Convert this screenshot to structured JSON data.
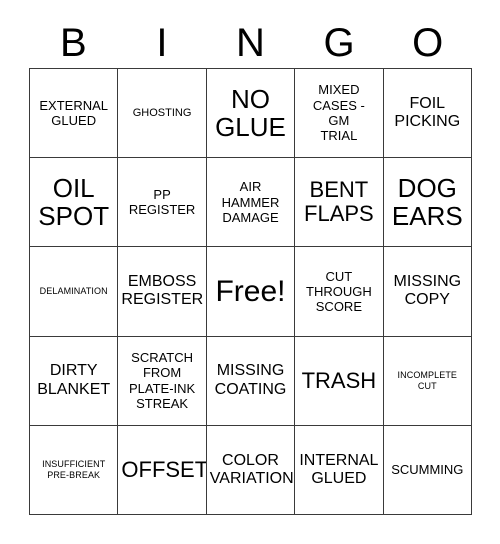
{
  "card": {
    "title": "BINGO",
    "header_letters": [
      "B",
      "I",
      "N",
      "G",
      "O"
    ],
    "colors": {
      "background": "#ffffff",
      "text": "#000000",
      "grid_line": "#3a3a3a"
    },
    "free_space": {
      "row": 3,
      "column": 3,
      "label": "Free!"
    },
    "rows": [
      [
        {
          "text": "EXTERNAL\nGLUED",
          "size": "sm"
        },
        {
          "text": "GHOSTING",
          "size": "xs"
        },
        {
          "text": "NO\nGLUE",
          "size": "xl"
        },
        {
          "text": "MIXED\nCASES -\nGM\nTRIAL",
          "size": "sm"
        },
        {
          "text": "FOIL\nPICKING",
          "size": "md"
        }
      ],
      [
        {
          "text": "OIL\nSPOT",
          "size": "xl"
        },
        {
          "text": "PP\nREGISTER",
          "size": "sm"
        },
        {
          "text": "AIR\nHAMMER\nDAMAGE",
          "size": "sm"
        },
        {
          "text": "BENT\nFLAPS",
          "size": "lg"
        },
        {
          "text": "DOG\nEARS",
          "size": "xl"
        }
      ],
      [
        {
          "text": "DELAMINATION",
          "size": "xxs"
        },
        {
          "text": "EMBOSS\nREGISTER",
          "size": "md"
        },
        {
          "text": "Free!",
          "size": "xxl"
        },
        {
          "text": "CUT\nTHROUGH\nSCORE",
          "size": "sm"
        },
        {
          "text": "MISSING\nCOPY",
          "size": "md"
        }
      ],
      [
        {
          "text": "DIRTY\nBLANKET",
          "size": "md"
        },
        {
          "text": "SCRATCH\nFROM\nPLATE-INK\nSTREAK",
          "size": "sm"
        },
        {
          "text": "MISSING\nCOATING",
          "size": "md"
        },
        {
          "text": "TRASH",
          "size": "lg"
        },
        {
          "text": "INCOMPLETE\nCUT",
          "size": "xxs"
        }
      ],
      [
        {
          "text": "INSUFFICIENT\nPRE-BREAK",
          "size": "xxs"
        },
        {
          "text": "OFFSET",
          "size": "lg"
        },
        {
          "text": "COLOR\nVARIATION",
          "size": "md"
        },
        {
          "text": "INTERNAL\nGLUED",
          "size": "md"
        },
        {
          "text": "SCUMMING",
          "size": "sm"
        }
      ]
    ]
  }
}
